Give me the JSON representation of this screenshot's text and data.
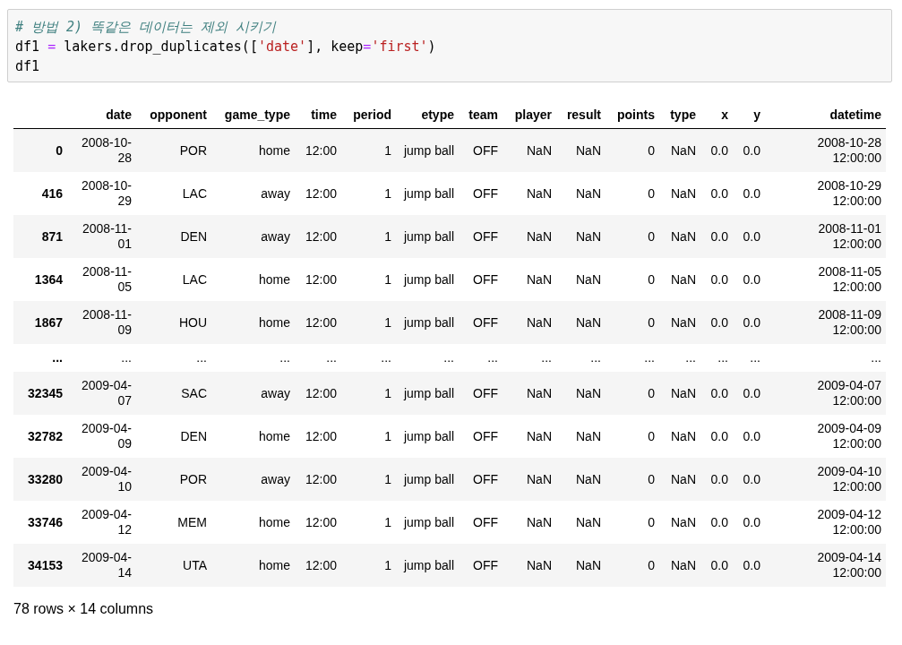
{
  "code_cell": {
    "lines": [
      [
        {
          "kind": "comment",
          "text": "# 방법 2) 똑같은 데이터는 제외 시키기"
        }
      ],
      [
        {
          "kind": "plain",
          "text": "df1 "
        },
        {
          "kind": "operator",
          "text": "="
        },
        {
          "kind": "plain",
          "text": " lakers.drop_duplicates(["
        },
        {
          "kind": "string",
          "text": "'date'"
        },
        {
          "kind": "plain",
          "text": "], keep"
        },
        {
          "kind": "operator",
          "text": "="
        },
        {
          "kind": "string",
          "text": "'first'"
        },
        {
          "kind": "plain",
          "text": ")"
        }
      ],
      [
        {
          "kind": "plain",
          "text": "df1"
        }
      ]
    ]
  },
  "table": {
    "columns": [
      "date",
      "opponent",
      "game_type",
      "time",
      "period",
      "etype",
      "team",
      "player",
      "result",
      "points",
      "type",
      "x",
      "y",
      "datetime"
    ],
    "rows": [
      {
        "index": "0",
        "cells": [
          "2008-10-28",
          "POR",
          "home",
          "12:00",
          "1",
          "jump ball",
          "OFF",
          "NaN",
          "NaN",
          "0",
          "NaN",
          "0.0",
          "0.0",
          "2008-10-28 12:00:00"
        ]
      },
      {
        "index": "416",
        "cells": [
          "2008-10-29",
          "LAC",
          "away",
          "12:00",
          "1",
          "jump ball",
          "OFF",
          "NaN",
          "NaN",
          "0",
          "NaN",
          "0.0",
          "0.0",
          "2008-10-29 12:00:00"
        ]
      },
      {
        "index": "871",
        "cells": [
          "2008-11-01",
          "DEN",
          "away",
          "12:00",
          "1",
          "jump ball",
          "OFF",
          "NaN",
          "NaN",
          "0",
          "NaN",
          "0.0",
          "0.0",
          "2008-11-01 12:00:00"
        ]
      },
      {
        "index": "1364",
        "cells": [
          "2008-11-05",
          "LAC",
          "home",
          "12:00",
          "1",
          "jump ball",
          "OFF",
          "NaN",
          "NaN",
          "0",
          "NaN",
          "0.0",
          "0.0",
          "2008-11-05 12:00:00"
        ]
      },
      {
        "index": "1867",
        "cells": [
          "2008-11-09",
          "HOU",
          "home",
          "12:00",
          "1",
          "jump ball",
          "OFF",
          "NaN",
          "NaN",
          "0",
          "NaN",
          "0.0",
          "0.0",
          "2008-11-09 12:00:00"
        ]
      },
      {
        "index": "...",
        "cells": [
          "...",
          "...",
          "...",
          "...",
          "...",
          "...",
          "...",
          "...",
          "...",
          "...",
          "...",
          "...",
          "...",
          "..."
        ]
      },
      {
        "index": "32345",
        "cells": [
          "2009-04-07",
          "SAC",
          "away",
          "12:00",
          "1",
          "jump ball",
          "OFF",
          "NaN",
          "NaN",
          "0",
          "NaN",
          "0.0",
          "0.0",
          "2009-04-07 12:00:00"
        ]
      },
      {
        "index": "32782",
        "cells": [
          "2009-04-09",
          "DEN",
          "home",
          "12:00",
          "1",
          "jump ball",
          "OFF",
          "NaN",
          "NaN",
          "0",
          "NaN",
          "0.0",
          "0.0",
          "2009-04-09 12:00:00"
        ]
      },
      {
        "index": "33280",
        "cells": [
          "2009-04-10",
          "POR",
          "away",
          "12:00",
          "1",
          "jump ball",
          "OFF",
          "NaN",
          "NaN",
          "0",
          "NaN",
          "0.0",
          "0.0",
          "2009-04-10 12:00:00"
        ]
      },
      {
        "index": "33746",
        "cells": [
          "2009-04-12",
          "MEM",
          "home",
          "12:00",
          "1",
          "jump ball",
          "OFF",
          "NaN",
          "NaN",
          "0",
          "NaN",
          "0.0",
          "0.0",
          "2009-04-12 12:00:00"
        ]
      },
      {
        "index": "34153",
        "cells": [
          "2009-04-14",
          "UTA",
          "home",
          "12:00",
          "1",
          "jump ball",
          "OFF",
          "NaN",
          "NaN",
          "0",
          "NaN",
          "0.0",
          "0.0",
          "2009-04-14 12:00:00"
        ]
      }
    ]
  },
  "summary": "78 rows × 14 columns"
}
